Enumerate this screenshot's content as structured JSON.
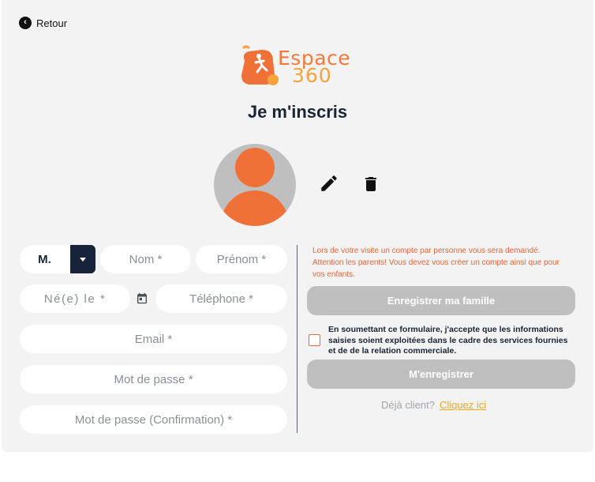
{
  "nav": {
    "back_label": "Retour"
  },
  "logo": {
    "word": "Espace",
    "number": "360"
  },
  "page_title": "Je m'inscris",
  "form": {
    "civility": {
      "value": "M."
    },
    "nom_placeholder": "Nom *",
    "prenom_placeholder": "Prénom *",
    "birthdate_placeholder": "Né(e) le *",
    "phone_placeholder": "Téléphone *",
    "email_placeholder": "Email *",
    "password_placeholder": "Mot de passe *",
    "password_confirm_placeholder": "Mot de passe (Confirmation) *"
  },
  "notice": "Lors de votre visite un compte par personne vous sera demandé. Attention les parents! Vous devez vous créer un compte ainsi que pour vos enfants.",
  "buttons": {
    "register_family": "Enregistrer ma famille",
    "register_me": "M'enregistrer"
  },
  "consent": "En soumettant ce formulaire, j'accepte que les informations saisies soient exploitées dans le cadre des services fournies et de de la relation commerciale.",
  "already_client": {
    "text": "Déjà client?",
    "link": "Cliquez ici"
  },
  "colors": {
    "brand_orange": "#f07138",
    "brand_yellow": "#f7a23b",
    "navy": "#16233a",
    "disabled_button": "#bfbfbf",
    "link": "#f5a623"
  }
}
